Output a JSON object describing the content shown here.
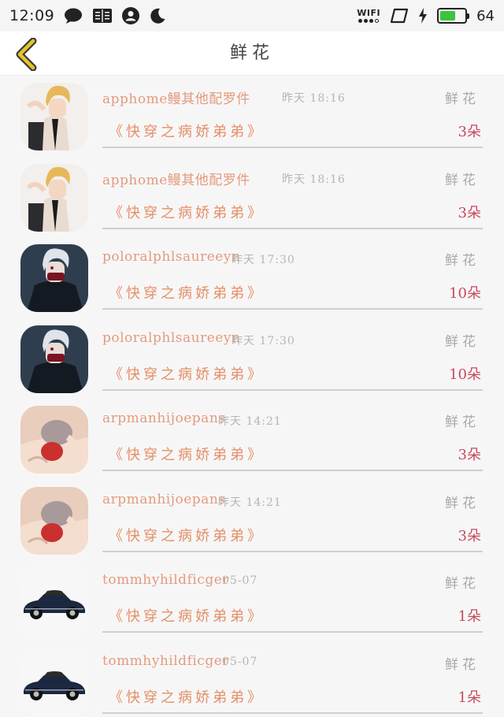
{
  "status_bar": {
    "time": "12:09",
    "wifi_label": "WIFI",
    "battery_level": "64",
    "battery_percent": 0.64
  },
  "header": {
    "title": "鲜花"
  },
  "records": [
    {
      "username": "apphome鳗其他配罗件",
      "time": "昨天 18:16",
      "gift": "鲜花",
      "book": "《快穿之病娇弟弟》",
      "count": "3朵",
      "avatar": "blond-anime-boy"
    },
    {
      "username": "apphome鳗其他配罗件",
      "time": "昨天 18:16",
      "gift": "鲜花",
      "book": "《快穿之病娇弟弟》",
      "count": "3朵",
      "avatar": "blond-anime-boy"
    },
    {
      "username": "poloralphlsaureeyn",
      "time": "昨天 17:30",
      "gift": "鲜花",
      "book": "《快穿之病娇弟弟》",
      "count": "10朵",
      "avatar": "white-hair-anime-boy"
    },
    {
      "username": "poloralphlsaureeyn",
      "time": "昨天 17:30",
      "gift": "鲜花",
      "book": "《快穿之病娇弟弟》",
      "count": "10朵",
      "avatar": "white-hair-anime-boy"
    },
    {
      "username": "arpmanhijoepans",
      "time": "昨天 14:21",
      "gift": "鲜花",
      "book": "《快穿之病娇弟弟》",
      "count": "3朵",
      "avatar": "sleeping-anime-couple"
    },
    {
      "username": "arpmanhijoepans",
      "time": "昨天 14:21",
      "gift": "鲜花",
      "book": "《快穿之病娇弟弟》",
      "count": "3朵",
      "avatar": "sleeping-anime-couple"
    },
    {
      "username": "tommhyhildficger",
      "time": "05-07",
      "gift": "鲜花",
      "book": "《快穿之病娇弟弟》",
      "count": "1朵",
      "avatar": "vintage-car"
    },
    {
      "username": "tommhyhildficger",
      "time": "05-07",
      "gift": "鲜花",
      "book": "《快穿之病娇弟弟》",
      "count": "1朵",
      "avatar": "vintage-car"
    }
  ],
  "colors": {
    "username": "#e39b7c",
    "book": "#e48f66",
    "count": "#c64a5e",
    "back_arrow": "#e5c52a",
    "battery": "#3cc43c"
  }
}
